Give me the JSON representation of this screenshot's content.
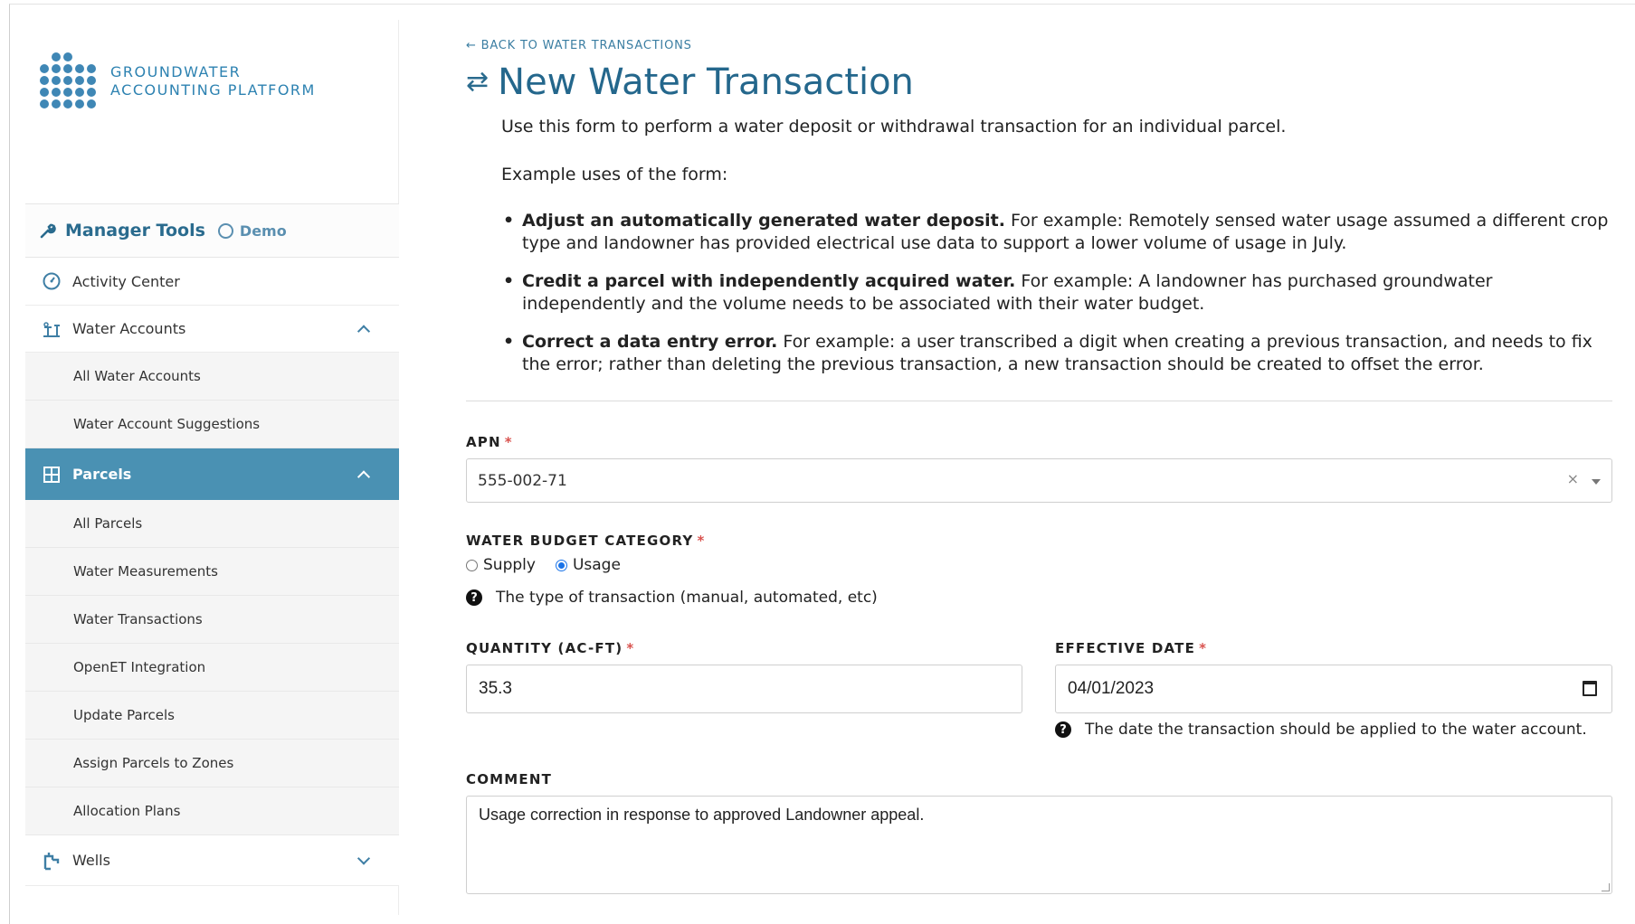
{
  "brand": {
    "line1": "GROUNDWATER",
    "line2": "ACCOUNTING PLATFORM"
  },
  "sidebar": {
    "manager_title": "Manager Tools",
    "manager_badge": "Demo",
    "items": [
      {
        "label": "Activity Center",
        "icon": "dashboard-icon"
      },
      {
        "label": "Water Accounts",
        "icon": "water-account-icon",
        "expanded": true
      },
      {
        "label": "Parcels",
        "icon": "grid-icon",
        "expanded": true,
        "active": true
      },
      {
        "label": "Wells",
        "icon": "well-icon",
        "expanded": false
      }
    ],
    "water_accounts_sub": [
      "All Water Accounts",
      "Water Account Suggestions"
    ],
    "parcels_sub": [
      "All Parcels",
      "Water Measurements",
      "Water Transactions",
      "OpenET Integration",
      "Update Parcels",
      "Assign Parcels to Zones",
      "Allocation Plans"
    ]
  },
  "main": {
    "back_link": "← BACK TO WATER TRANSACTIONS",
    "title": "New Water Transaction",
    "intro": "Use this form to perform a water deposit or withdrawal transaction for an individual parcel.",
    "examples_heading": "Example uses of the form:",
    "examples": [
      {
        "bold": "Adjust an automatically generated water deposit.",
        "text": " For example: Remotely sensed water usage assumed a different crop type and landowner has provided electrical use data to support a lower volume of usage in July."
      },
      {
        "bold": "Credit a parcel with independently acquired water.",
        "text": " For example: A landowner has purchased groundwater independently and the volume needs to be associated with their water budget."
      },
      {
        "bold": "Correct a data entry error.",
        "text": " For example: a user transcribed a digit when creating a previous transaction, and needs to fix the error; rather than deleting the previous transaction, a new transaction should be created to offset the error."
      }
    ]
  },
  "form": {
    "apn_label": "APN",
    "apn_value": "555-002-71",
    "category_label": "WATER BUDGET CATEGORY",
    "category_options": [
      "Supply",
      "Usage"
    ],
    "category_selected": "Usage",
    "category_help": "The type of transaction (manual, automated, etc)",
    "quantity_label": "QUANTITY (AC-FT)",
    "quantity_value": "35.3",
    "date_label": "EFFECTIVE DATE",
    "date_value": "04/01/2023",
    "date_help": "The date the transaction should be applied to the water account.",
    "comment_label": "COMMENT",
    "comment_value": "Usage correction in response to approved Landowner appeal.",
    "required_marker": "*"
  },
  "colors": {
    "accent": "#4a91b3",
    "title": "#24678c",
    "required": "#d9534f"
  }
}
